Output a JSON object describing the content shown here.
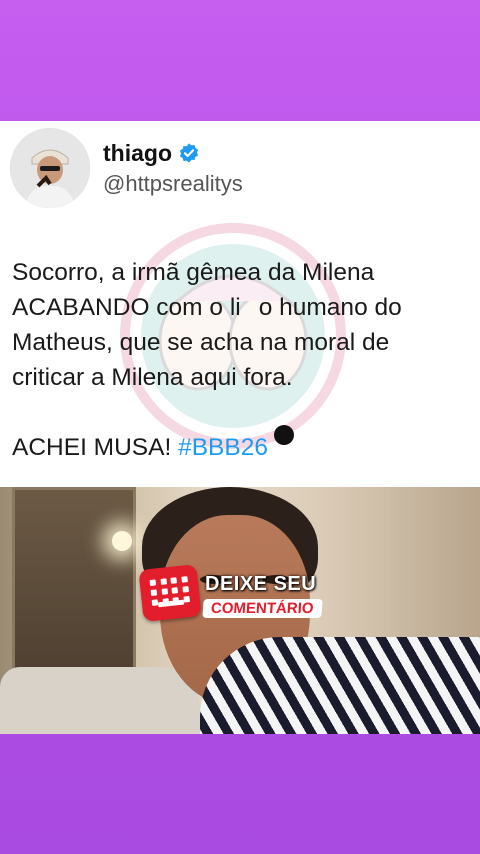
{
  "post": {
    "display_name": "thiago",
    "handle": "@httpsrealitys",
    "text_line1": "Socorro, a irmã gêmea da Milena",
    "text_line2": "ACABANDO com o li",
    "text_line2b": "o humano do",
    "text_line3": "Matheus, que se acha na moral de",
    "text_line4": "criticar a Milena aqui fora.",
    "text_line5": "ACHEI MUSA! ",
    "hashtag": "#BBB26"
  },
  "cta": {
    "line1": "DEIXE SEU",
    "line2": "COMENTÁRIO"
  },
  "colors": {
    "background": "#b24fe6",
    "verified": "#1d9bf0",
    "hashtag": "#1d9bf0",
    "cta_red": "#e21d2c"
  },
  "icons": [
    "verified-badge-icon",
    "keyboard-icon"
  ]
}
